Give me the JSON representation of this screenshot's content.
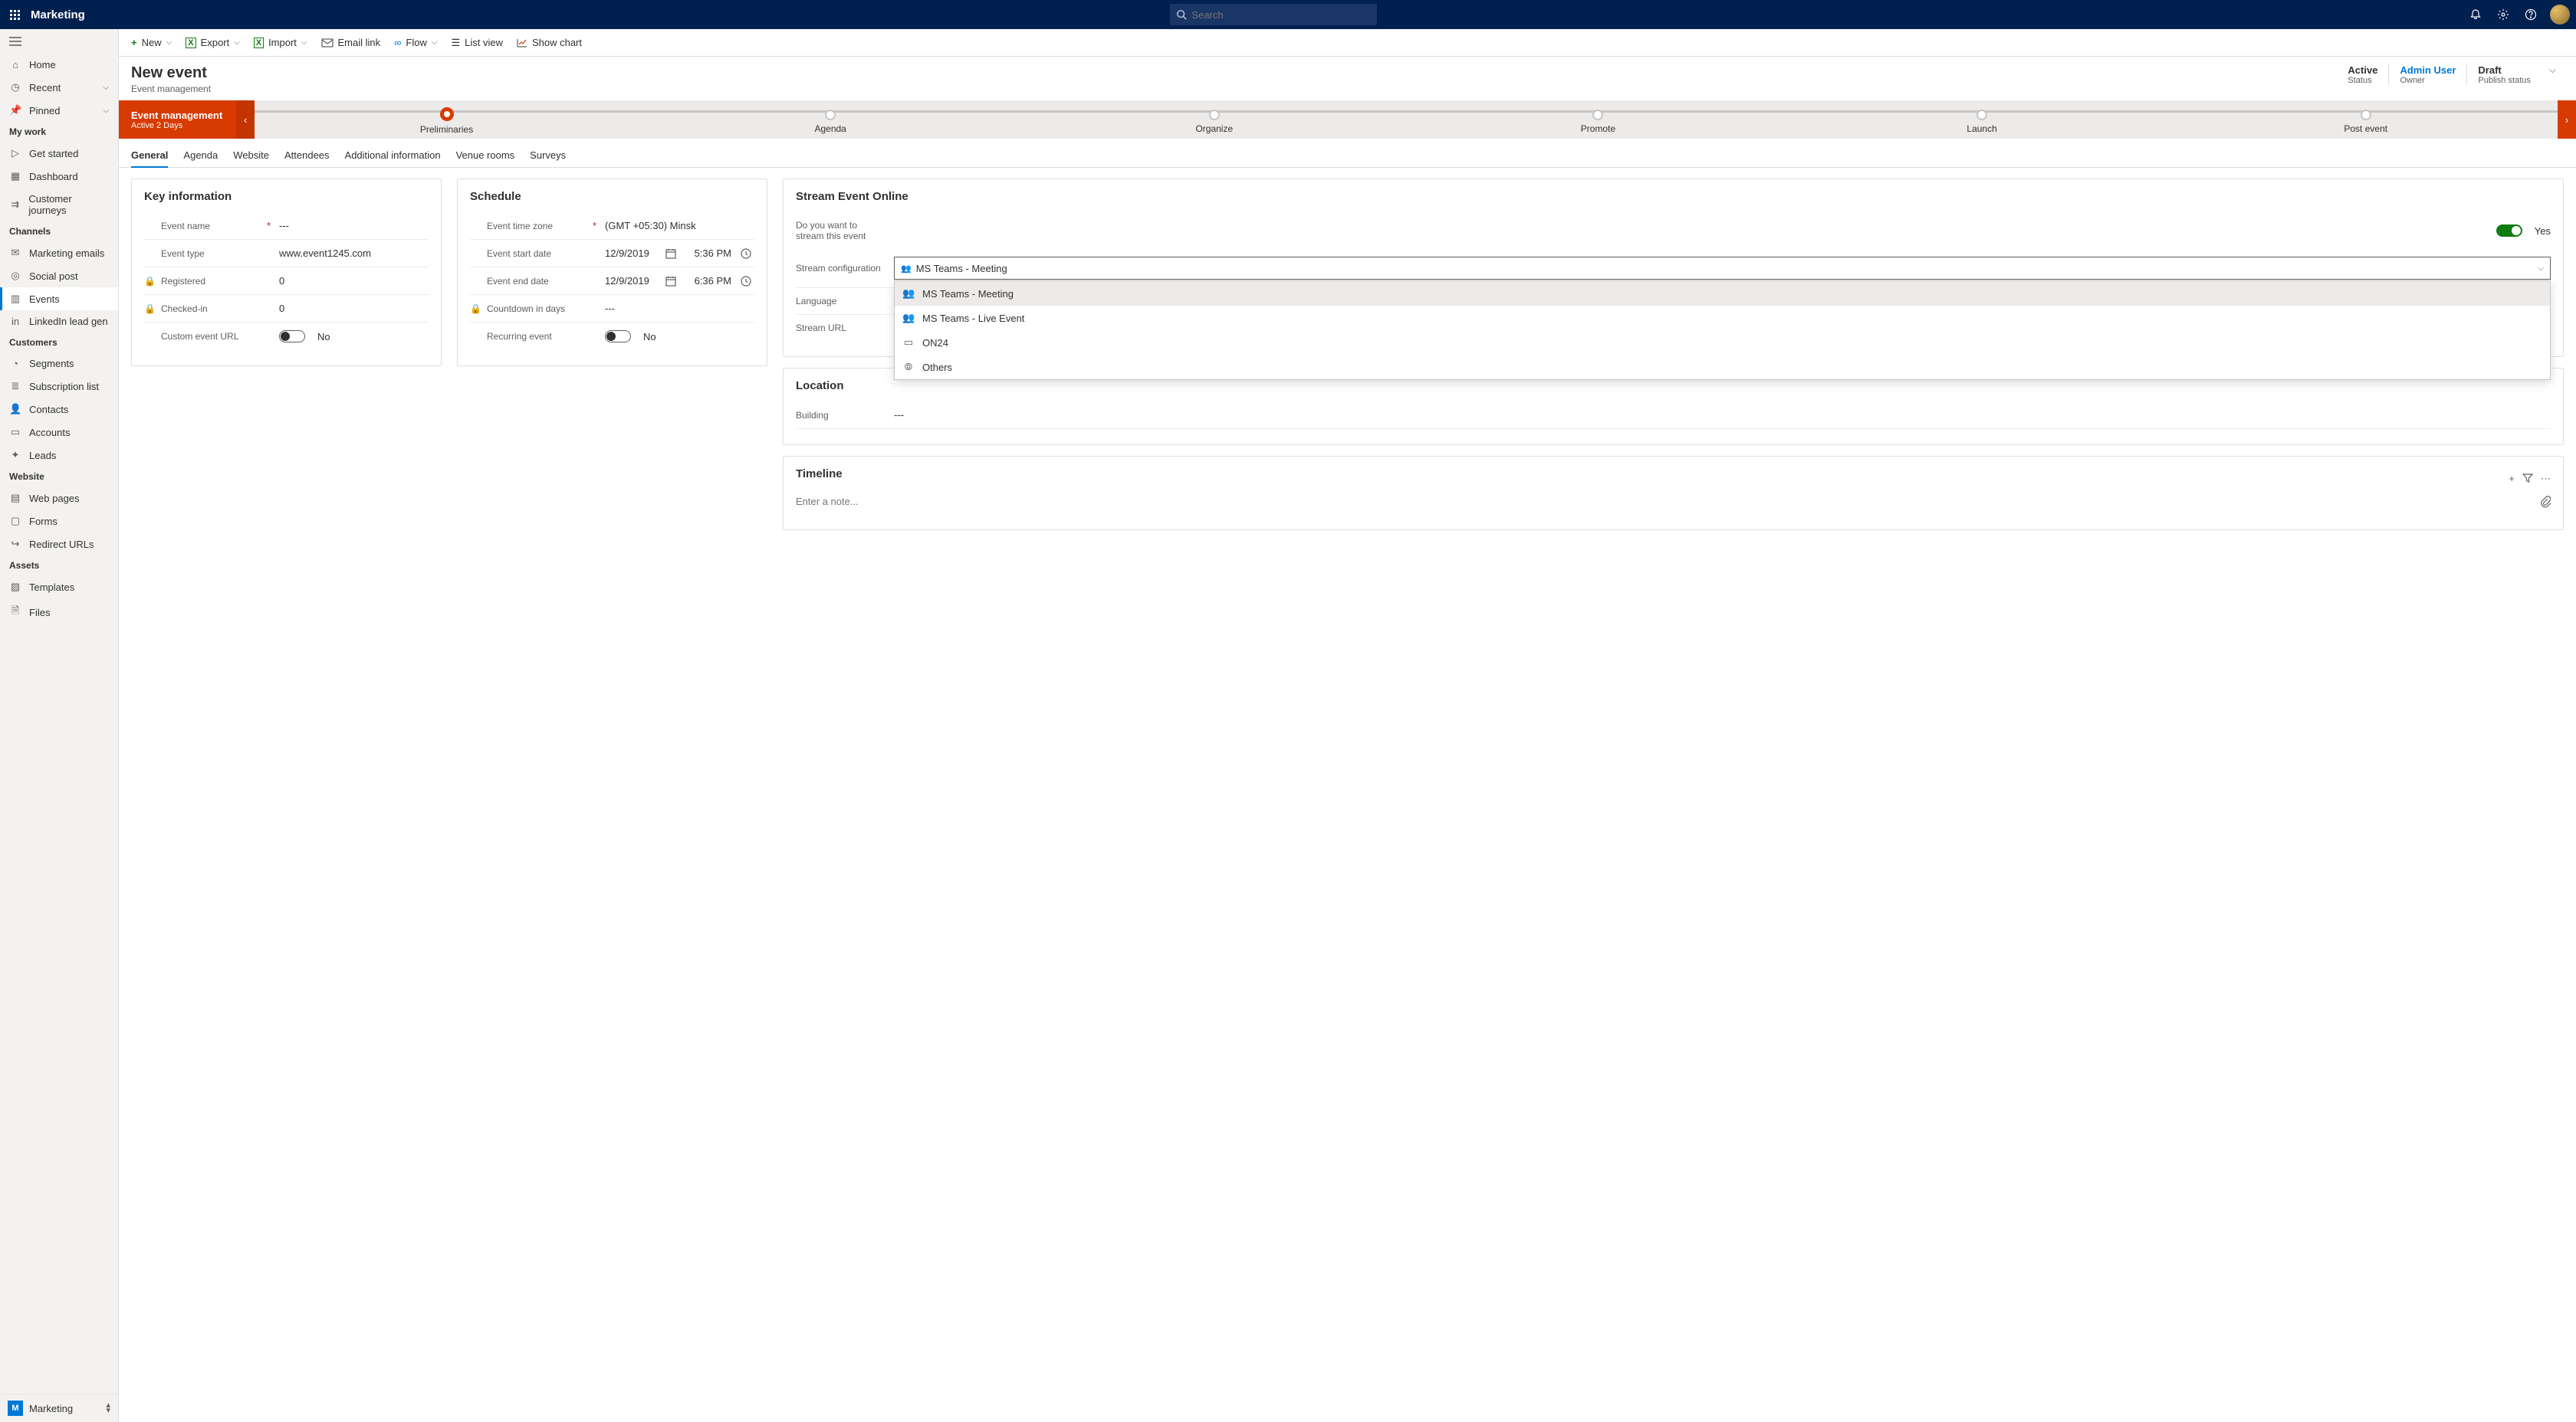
{
  "app": {
    "title": "Marketing",
    "search_placeholder": "Search"
  },
  "sidebar": {
    "top": [
      {
        "icon": "home",
        "label": "Home"
      },
      {
        "icon": "clock",
        "label": "Recent",
        "chev": true
      },
      {
        "icon": "pin",
        "label": "Pinned",
        "chev": true
      }
    ],
    "groups": [
      {
        "title": "My work",
        "items": [
          {
            "icon": "play",
            "label": "Get started"
          },
          {
            "icon": "dashboard",
            "label": "Dashboard"
          },
          {
            "icon": "journey",
            "label": "Customer journeys"
          }
        ]
      },
      {
        "title": "Channels",
        "items": [
          {
            "icon": "mail",
            "label": "Marketing emails"
          },
          {
            "icon": "social",
            "label": "Social post"
          },
          {
            "icon": "calendar",
            "label": "Events",
            "active": true
          },
          {
            "icon": "linkedin",
            "label": "LinkedIn lead gen"
          }
        ]
      },
      {
        "title": "Customers",
        "items": [
          {
            "icon": "segments",
            "label": "Segments"
          },
          {
            "icon": "list",
            "label": "Subscription list"
          },
          {
            "icon": "person",
            "label": "Contacts"
          },
          {
            "icon": "accounts",
            "label": "Accounts"
          },
          {
            "icon": "leads",
            "label": "Leads"
          }
        ]
      },
      {
        "title": "Website",
        "items": [
          {
            "icon": "page",
            "label": "Web pages"
          },
          {
            "icon": "form",
            "label": "Forms"
          },
          {
            "icon": "redirect",
            "label": "Redirect URLs"
          }
        ]
      },
      {
        "title": "Assets",
        "items": [
          {
            "icon": "template",
            "label": "Templates"
          },
          {
            "icon": "files",
            "label": "Files"
          }
        ]
      }
    ],
    "footer": {
      "badge": "M",
      "label": "Marketing"
    }
  },
  "commands": {
    "new": "New",
    "export": "Export",
    "import": "Import",
    "email_link": "Email link",
    "flow": "Flow",
    "list_view": "List view",
    "show_chart": "Show chart"
  },
  "header": {
    "title": "New event",
    "subtitle": "Event management",
    "status": [
      {
        "value": "Active",
        "label": "Status"
      },
      {
        "value": "Admin User",
        "label": "Owner",
        "link": true
      },
      {
        "value": "Draft",
        "label": "Publish status"
      }
    ]
  },
  "stagebar": {
    "current_title": "Event management",
    "current_sub": "Active 2 Days",
    "stages": [
      "Preliminaries",
      "Agenda",
      "Organize",
      "Promote",
      "Launch",
      "Post event"
    ],
    "active_index": 0
  },
  "tabs": [
    "General",
    "Agenda",
    "Website",
    "Attendees",
    "Additional information",
    "Venue rooms",
    "Surveys"
  ],
  "active_tab": 0,
  "key_info": {
    "title": "Key information",
    "event_name_label": "Event name",
    "event_name": "---",
    "event_type_label": "Event type",
    "event_type": "www.event1245.com",
    "registered_label": "Registered",
    "registered": "0",
    "checked_in_label": "Checked-in",
    "checked_in": "0",
    "custom_url_label": "Custom event URL",
    "custom_url_toggle": "No"
  },
  "schedule": {
    "title": "Schedule",
    "tz_label": "Event time zone",
    "tz": "(GMT +05:30) Minsk",
    "start_label": "Event start date",
    "start_date": "12/9/2019",
    "start_time": "5:36 PM",
    "end_label": "Event end date",
    "end_date": "12/9/2019",
    "end_time": "6:36 PM",
    "countdown_label": "Countdown in days",
    "countdown": "---",
    "recurring_label": "Recurring event",
    "recurring_toggle": "No"
  },
  "stream": {
    "title": "Stream Event Online",
    "q_label": "Do you want to stream this event",
    "q_toggle": "Yes",
    "config_label": "Stream configuration",
    "config_value": "MS Teams - Meeting",
    "options": [
      {
        "icon": "teams",
        "label": "MS Teams - Meeting"
      },
      {
        "icon": "teams",
        "label": "MS Teams - Live Event"
      },
      {
        "icon": "video",
        "label": "ON24"
      },
      {
        "icon": "globe",
        "label": "Others"
      }
    ],
    "language_label": "Language",
    "stream_url_label": "Stream URL"
  },
  "location": {
    "title": "Location",
    "building_label": "Building",
    "building": "---"
  },
  "timeline": {
    "title": "Timeline",
    "note_placeholder": "Enter a note..."
  }
}
